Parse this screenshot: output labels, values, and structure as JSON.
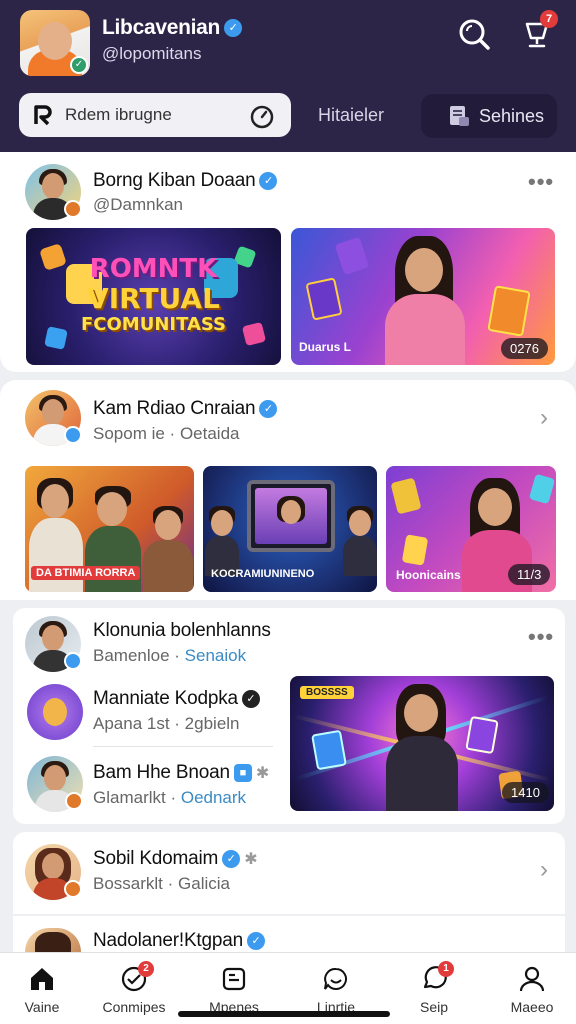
{
  "header": {
    "profile_name": "Libcavenian",
    "profile_handle": "@lopomitans",
    "search_placeholder": "Rdem ibrugne",
    "tab_header": "Hitaieler",
    "tab_sehines": "Sehines",
    "bell_badge": "7"
  },
  "post1": {
    "name": "Borng Kiban Doaan",
    "handle": "@Damnkan",
    "thumb1_line1": "ROMNTK",
    "thumb1_line2": "VIRTUAL",
    "thumb1_line3": "FCOMUNITASS",
    "thumb2_caption": "Duarus L",
    "thumb2_pill": "0276"
  },
  "post2": {
    "name": "Kam Rdiao Cnraian",
    "sub_a": "Sopom ie",
    "sub_b": "Oetaida",
    "thumb1_caption": "DA BTIMIA RORRA",
    "thumb2_caption": "KOCRAMIUNINENO",
    "thumb3_caption": "Hoonicains",
    "thumb3_pill": "11/3"
  },
  "group": {
    "name": "Klonunia bolenhlanns",
    "sub_a": "Bamenloe",
    "sub_b": "Senaiok",
    "item1_name": "Manniate Kodpka",
    "item1_sub_a": "Apana 1st",
    "item1_sub_b": "2gbieln",
    "item2_name": "Bam Hhe Bnoan",
    "item2_sub_a": "Glamarlkt",
    "item2_sub_b": "Oednark",
    "thumb_tag": "BOSSSS",
    "thumb_pill": "1410"
  },
  "post4": {
    "name": "Sobil Kdomaim",
    "sub_a": "Bossarklt",
    "sub_b": "Galicia"
  },
  "post5": {
    "name": "Nadolaner!Ktgpan"
  },
  "nav": {
    "home": "Vaine",
    "communities": "Conmipes",
    "messages": "Mpenes",
    "invite": "Linrtie",
    "chat": "Seip",
    "profile": "Maeeo",
    "communities_badge": "2",
    "chat_badge": "1"
  },
  "colors": {
    "header_bg": "#2c2547",
    "accent_blue": "#3d9bef",
    "badge_red": "#e23b3b"
  },
  "icons": [
    "search-icon",
    "bell-icon",
    "timer-icon",
    "document-icon",
    "more-icon",
    "chevron-right-icon",
    "home-icon",
    "communities-icon",
    "messages-icon",
    "invite-icon",
    "chat-icon",
    "profile-icon",
    "verified-icon",
    "gear-icon"
  ]
}
